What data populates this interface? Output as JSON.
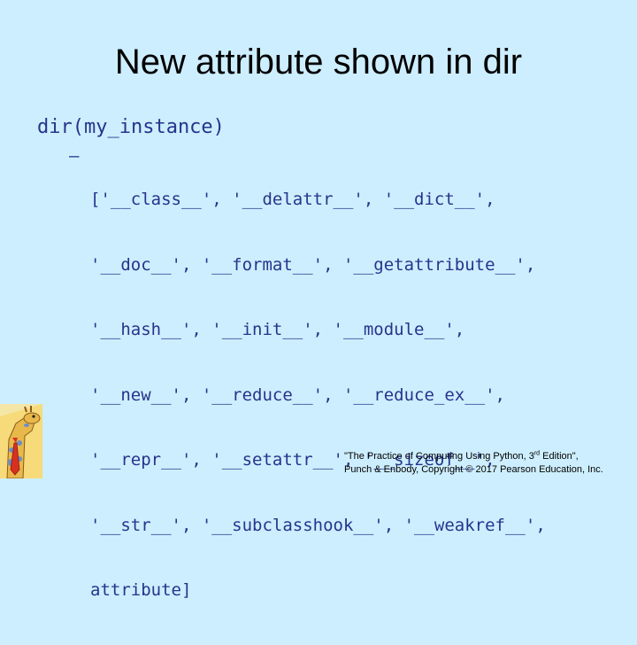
{
  "slide": {
    "title": "New attribute shown in dir",
    "bullet": "dir(my_instance)",
    "sub_bullet_marker": "–",
    "sub_bullet_lines": [
      "['__class__', '__delattr__', '__dict__',",
      "'__doc__', '__format__', '__getattribute__',",
      "'__hash__', '__init__', '__module__',",
      "'__new__', '__reduce__', '__reduce_ex__',",
      "'__repr__', '__setattr__', '__sizeof__',",
      "'__str__', '__subclasshook__', '__weakref__',",
      "attribute]"
    ]
  },
  "footer": {
    "line1_pre": "\"The Practice of Computing Using Python, 3",
    "line1_sup": "rd",
    "line1_post": " Edition\",",
    "line2": "Punch & Enbody, Copyright © 2017 Pearson Education, Inc."
  },
  "colors": {
    "background": "#cdeefe",
    "title": "#000000",
    "code": "#26348c"
  },
  "icons": {
    "mascot": "giraffe-with-tie-icon"
  }
}
